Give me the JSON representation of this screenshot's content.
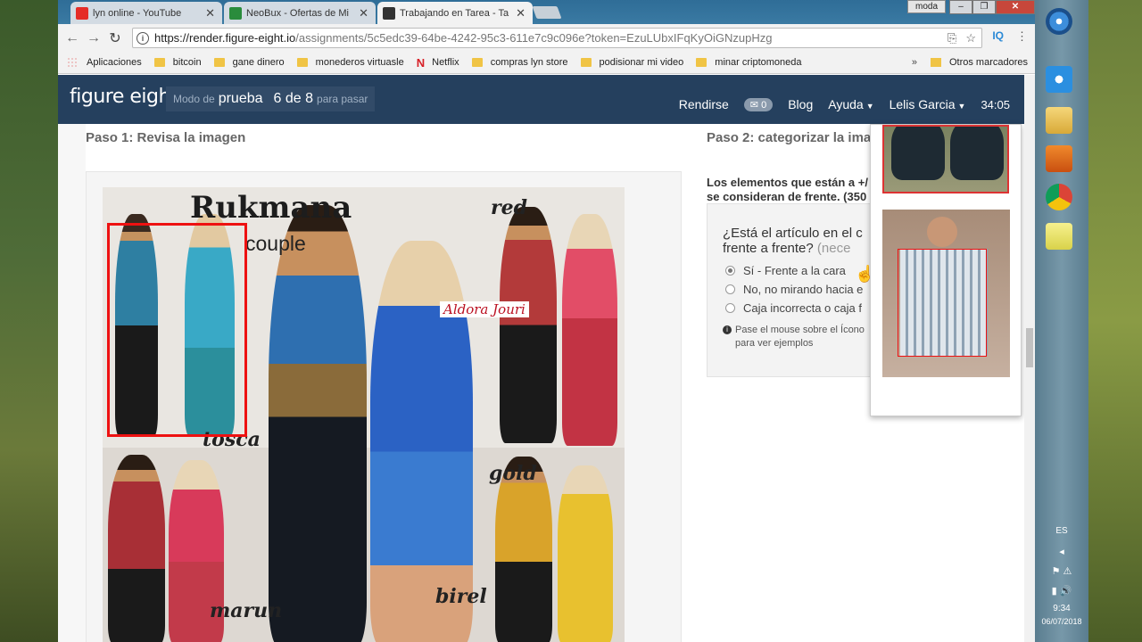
{
  "tabs": [
    {
      "title": "lyn online - YouTube",
      "color": "#e52d27"
    },
    {
      "title": "NeoBux - Ofertas de Mi",
      "color": "#2a8c3c"
    },
    {
      "title": "Trabajando en Tarea - Ta",
      "color": "#333333"
    }
  ],
  "window": {
    "profile": "moda"
  },
  "address": {
    "url_main": "https://render.figure-eight.io",
    "url_rest": "/assignments/5c5edc39-64be-4242-95c3-611e7c9c096e?token=EzuLUbxIFqKyOiGNzupHzg"
  },
  "bookmarks": {
    "items": [
      "Aplicaciones",
      "bitcoin",
      "gane dinero",
      "monederos virtuasle",
      "Netflix",
      "compras lyn store",
      "podisionar mi video",
      "minar criptomoneda"
    ],
    "more": "»",
    "other": "Otros marcadores"
  },
  "header": {
    "logo": "figure eight",
    "mode_prefix": "Modo de",
    "mode_value": "prueba",
    "progress": "6 de 8",
    "progress_suffix": "para pasar",
    "nav": {
      "give_up": "Rendirse",
      "mail_count": "0",
      "blog": "Blog",
      "help": "Ayuda",
      "user": "Lelis Garcia",
      "timer": "34:05"
    }
  },
  "main": {
    "step1": "Paso 1: Revisa la imagen",
    "step2": "Paso 2: categorizar la ima",
    "note_line1": "Los elementos que están a +/",
    "note_line2": "se consideran de frente. (350",
    "question_line1": "¿Está el artículo en el c",
    "question_line2": "frente a frente?",
    "question_req": "(nece",
    "options": [
      "Sí - Frente a la cara",
      "No, no mirando hacia e",
      "Caja incorrecta o caja f"
    ],
    "selected": 0,
    "hint_line1": "Pase el mouse sobre el Ícono",
    "hint_line2": "para ver ejemplos"
  },
  "photo": {
    "brand": "Rukmana",
    "brand_sub": "couple",
    "labels": [
      "red",
      "tosca",
      "gold",
      "marun",
      "birel"
    ],
    "watermark": "Aldora Jouri"
  },
  "tray": {
    "lang": "ES",
    "time": "9:34",
    "date": "06/07/2018"
  }
}
